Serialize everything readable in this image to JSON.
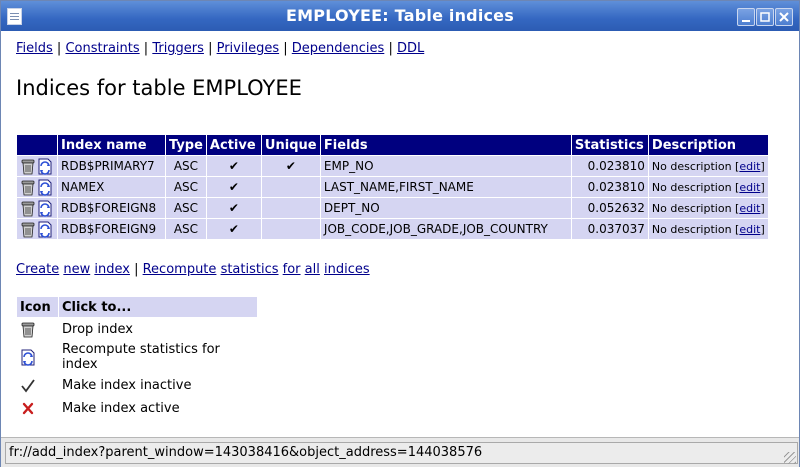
{
  "window": {
    "title": "EMPLOYEE: Table indices"
  },
  "nav": {
    "fields": "Fields",
    "constraints": "Constraints",
    "triggers": "Triggers",
    "privileges": "Privileges",
    "dependencies": "Dependencies",
    "ddl": "DDL",
    "separator": "|"
  },
  "page_title": "Indices for table EMPLOYEE",
  "indices_table": {
    "headers": [
      "Index name",
      "Type",
      "Active",
      "Unique",
      "Fields",
      "Statistics",
      "Description"
    ],
    "rows": [
      {
        "name": "RDB$PRIMARY7",
        "type": "ASC",
        "active": "✔",
        "unique": "✔",
        "fields": "EMP_NO",
        "statistics": "0.023810",
        "description": "No description",
        "edit": "edit"
      },
      {
        "name": "NAMEX",
        "type": "ASC",
        "active": "✔",
        "unique": "",
        "fields": "LAST_NAME,FIRST_NAME",
        "statistics": "0.023810",
        "description": "No description",
        "edit": "edit"
      },
      {
        "name": "RDB$FOREIGN8",
        "type": "ASC",
        "active": "✔",
        "unique": "",
        "fields": "DEPT_NO",
        "statistics": "0.052632",
        "description": "No description",
        "edit": "edit"
      },
      {
        "name": "RDB$FOREIGN9",
        "type": "ASC",
        "active": "✔",
        "unique": "",
        "fields": "JOB_CODE,JOB_GRADE,JOB_COUNTRY",
        "statistics": "0.037037",
        "description": "No description",
        "edit": "edit"
      }
    ]
  },
  "actions": {
    "create": "Create",
    "new": "new",
    "index": "index",
    "separator": "|",
    "recompute": "Recompute",
    "statistics": "statistics",
    "for": "for",
    "all": "all",
    "indices": "indices"
  },
  "legend": {
    "headers": [
      "Icon",
      "Click to..."
    ],
    "rows": [
      {
        "icon": "trash-can-icon",
        "text": "Drop index"
      },
      {
        "icon": "recompute-page-icon",
        "text": "Recompute statistics for index"
      },
      {
        "icon": "checkmark-icon",
        "text": "Make index inactive"
      },
      {
        "icon": "red-x-icon",
        "text": "Make index active"
      }
    ]
  },
  "status_bar": {
    "text": "fr://add_index?parent_window=143038416&object_address=144038576"
  },
  "colors": {
    "header_bg": "#00007f",
    "row_bg": "#d5d5f2",
    "link": "#00008b",
    "title_bar": "#3467c1"
  }
}
